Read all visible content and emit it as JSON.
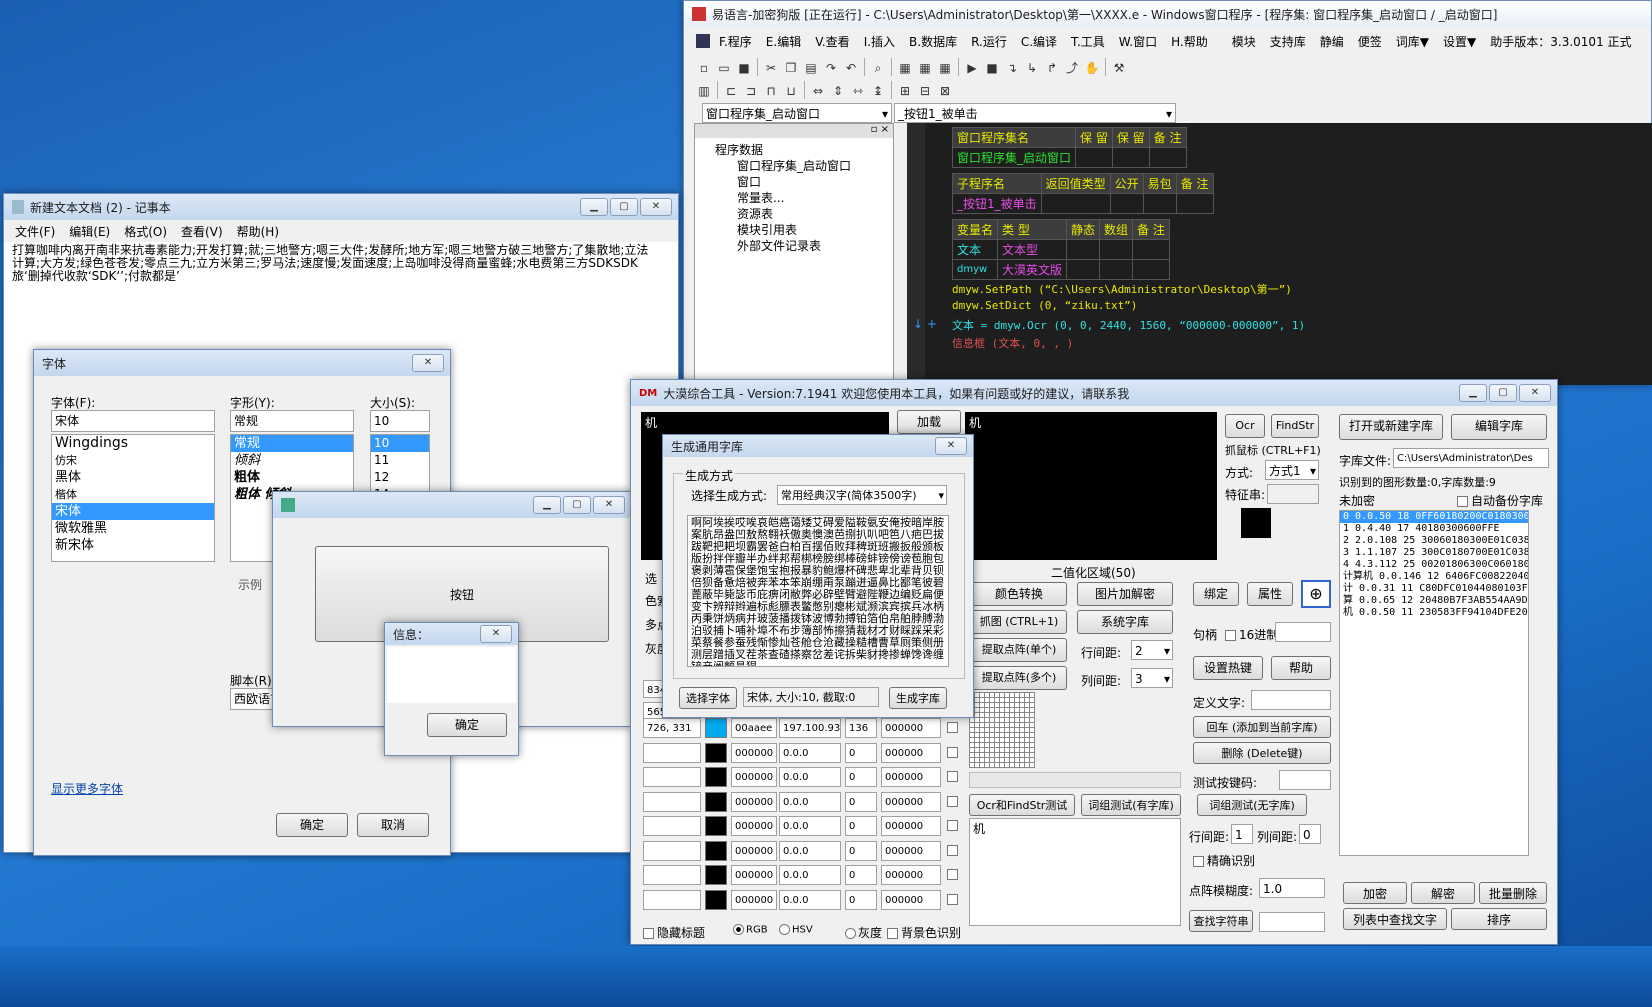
{
  "ide": {
    "title": "易语言-加密狗版 [正在运行] - C:\\Users\\Administrator\\Desktop\\第一\\XXXX.e - Windows窗口程序 - [程序集: 窗口程序集_启动窗口 / _启动窗口]",
    "menu": [
      "F.程序",
      "E.编辑",
      "V.查看",
      "I.插入",
      "B.数据库",
      "R.运行",
      "C.编译",
      "T.工具",
      "W.窗口",
      "H.帮助",
      "模块",
      "支持库",
      "静编",
      "便签",
      "词库▼",
      "设置▼",
      "助手版本：3.3.0101 正式"
    ],
    "combo1": "窗口程序集_启动窗口",
    "combo2": "_按钮1_被单击",
    "tree": [
      "程序数据",
      "窗口程序集_启动窗口",
      "窗口",
      "常量表...",
      "资源表",
      "模块引用表",
      "外部文件记录表"
    ],
    "t1": [
      "窗口程序集名",
      "保 留",
      "保 留",
      "备 注",
      "窗口程序集_启动窗口"
    ],
    "t2": [
      "子程序名",
      "返回值类型",
      "公开",
      "易包",
      "备 注",
      "_按钮1_被单击"
    ],
    "t3": [
      "变量名",
      "类 型",
      "静态",
      "数组",
      "备 注",
      "文本",
      "文本型",
      "dmyw",
      "大漠英文版"
    ],
    "code": [
      "dmyw.SetPath (“C:\\Users\\Administrator\\Desktop\\第一”)",
      "dmyw.SetDict (0, “ziku.txt”)",
      "文本 = dmyw.Ocr (0, 0, 2440, 1560, “000000-000000”, 1)",
      "信息框 (文本, 0, , )"
    ]
  },
  "notepad": {
    "title": "新建文本文档 (2) - 记事本",
    "menu": [
      "文件(F)",
      "编辑(E)",
      "格式(O)",
      "查看(V)",
      "帮助(H)"
    ],
    "text": "打算咖啡内离开南非来抗毒素能力;开发打算;就;三地警方;嗯三大件;发酵所;地方军;嗯三地警方破三地警方;了集散地;立法计算;大方发;绿色苍苍发;零点三九;立方米第三;罗马法;速度慢;发面速度;上岛咖啡没得商量蜜蜂;水电费第三方SDKSDK旅‘删掉代收款‘SDK‘’;付款都是’"
  },
  "font": {
    "title": "字体",
    "l_font": "字体(F):",
    "l_style": "字形(Y):",
    "l_size": "大小(S):",
    "v_font": "宋体",
    "v_style": "常规",
    "v_size": "10",
    "fonts": [
      "Wingdings",
      "仿宋",
      "黑体",
      "楷体",
      "宋体",
      "微软雅黑",
      "新宋体"
    ],
    "styles": [
      "常规",
      "倾斜",
      "粗体",
      "粗体 倾斜"
    ],
    "sizes": [
      "10",
      "11",
      "12",
      "14"
    ],
    "sample": "示例",
    "script": "脚本(R):",
    "script_val": "西欧语言",
    "more": "显示更多字体",
    "ok": "确定",
    "cancel": "取消"
  },
  "app": {
    "button": "按钮"
  },
  "msg": {
    "title": "信息：",
    "ok": "确定"
  },
  "dm": {
    "title": "大漠综合工具 -  Version:7.1941  欢迎您使用本工具，如果有问题或好的建议，请联系我",
    "screen_text": "机",
    "load": "加载",
    "ocr": "Ocr",
    "findstr": "FindStr",
    "open_lib": "打开或新建字库",
    "edit_lib": "编辑字库",
    "grab": "抓鼠标 (CTRL+F1)",
    "method_l": "方式:",
    "method_v": "方式1",
    "feature": "特征串:",
    "libfile_l": "字库文件:",
    "libfile_v": "C:\\Users\\Administrator\\Des",
    "count": "识别到的图形数量:0,字库数量:9",
    "unenc": "未加密",
    "autobak": "自动备份字库",
    "libitems": [
      "0 0.0.50 18 0FF60180200C0180300",
      "1 0.4.40 17 40180300600FFE",
      "2 2.0.108 25 30060180300E01C0380",
      "3 1.1.107 25 300C0180700E01C0380",
      "4 4.3.112 25 00201806300C0601807",
      "计算机 0.0.146 12 6406FC008220400",
      "计 0.0.31 11 C80DFC01044080103FF",
      "算 0.0.65 12 20480B7F3AB554AA9D5",
      "机 0.0.50 11 230583FF94104DFE200"
    ],
    "binarea": "二值化区域(50)",
    "colorconv": "颜色转换",
    "picdec": "图片加解密",
    "bind": "绑定",
    "prop": "属性",
    "grab2": "抓图 (CTRL+1)",
    "syslib": "系统字库",
    "handle": "句柄",
    "hex16": "16进制",
    "extract1": "提取点阵(单个)",
    "rowgap_l": "行间距:",
    "rowgap_v": "2",
    "hotkey": "设置热键",
    "help": "帮助",
    "extract2": "提取点阵(多个)",
    "colgap_l": "列间距:",
    "colgap_v": "3",
    "deftext": "定义文字:",
    "enter": "回车 (添加到当前字库)",
    "delete": "删除 (Delete键)",
    "testkey": "测试按键码:",
    "ocrtest": "Ocr和FindStr测试",
    "wg1": "词组测试(有字库)",
    "wg2": "词组测试(无字库)",
    "result": "机",
    "rowgap2": "行间距:",
    "rowgap2_v": "1",
    "colgap2": "列间距:",
    "colgap2_v": "0",
    "precise": "精确识别",
    "fuzzy_l": "点阵模糊度:",
    "fuzzy_v": "1.0",
    "findstr_btn": "查找字符串",
    "encrypt": "加密",
    "decrypt": "解密",
    "batchdel": "批量删除",
    "findtext": "列表中查找文字",
    "sort": "排序",
    "hide": "隐藏标题",
    "rgb": "RGB",
    "hsv": "HSV",
    "gray": "灰度",
    "bgrec": "背景色识别",
    "side": [
      "选",
      "色索",
      "多点",
      "灰度",
      "834",
      "565"
    ],
    "rows": [
      [
        "726, 331",
        "00aaee",
        "197.100.93",
        "136",
        "000000"
      ],
      [
        "",
        "000000",
        "0.0.0",
        "0",
        "000000"
      ],
      [
        "",
        "000000",
        "0.0.0",
        "0",
        "000000"
      ],
      [
        "",
        "000000",
        "0.0.0",
        "0",
        "000000"
      ],
      [
        "",
        "000000",
        "0.0.0",
        "0",
        "000000"
      ],
      [
        "",
        "000000",
        "0.0.0",
        "0",
        "000000"
      ],
      [
        "",
        "000000",
        "0.0.0",
        "0",
        "000000"
      ],
      [
        "",
        "000000",
        "0.0.0",
        "0",
        "000000"
      ]
    ]
  },
  "gen": {
    "title": "生成通用字库",
    "group": "生成方式",
    "sel_l": "选择生成方式:",
    "sel_v": "常用经典汉字(简体3500字)",
    "chars": "啊阿埃挨哎唉哀皑癌蔼矮艾碍爱隘鞍氨安俺按暗岸胺案肮昂盎凹敖熬翱袄傲奥懊澳芭捌扒叭吧笆八疤巴拔跋靶把耙坝霸罢爸白柏百摆佰败拜稗斑班搬扳般颁板版扮拌伴瓣半办绊邦帮梆榜膀绑棒磅蚌镑傍谤苞胞包褒剥薄雹保堡饱宝抱报暴豹鲍爆杯碑悲卑北辈背贝钡倍狈备惫焙被奔苯本笨崩绷甭泵蹦迸逼鼻比鄙笔彼碧蓖蔽毕毙毖币庇痹闭敝弊必辟壁臂避陛鞭边编贬扁便变卞辨辩辫遍标彪膘表鳖憋别瘪彬斌濒滨宾摈兵冰柄丙秉饼炳病并玻菠播拨钵波博勃搏铂箔伯帛舶脖膊渤泊驳捕卜哺补埠不布步簿部怖擦猜裁材才财睬踩采彩菜蔡餐参蚕残惭惨灿苍舱仓沧藏操糙槽曹草厕策侧册测层蹭插叉茬茶查碴搽察岔差诧拆柴豺搀掺蝉馋谗缠铲产阐颤昌猖",
    "pickfont": "选择字体",
    "fontinfo": "宋体, 大小:10, 截取:0",
    "genlib": "生成字库"
  }
}
